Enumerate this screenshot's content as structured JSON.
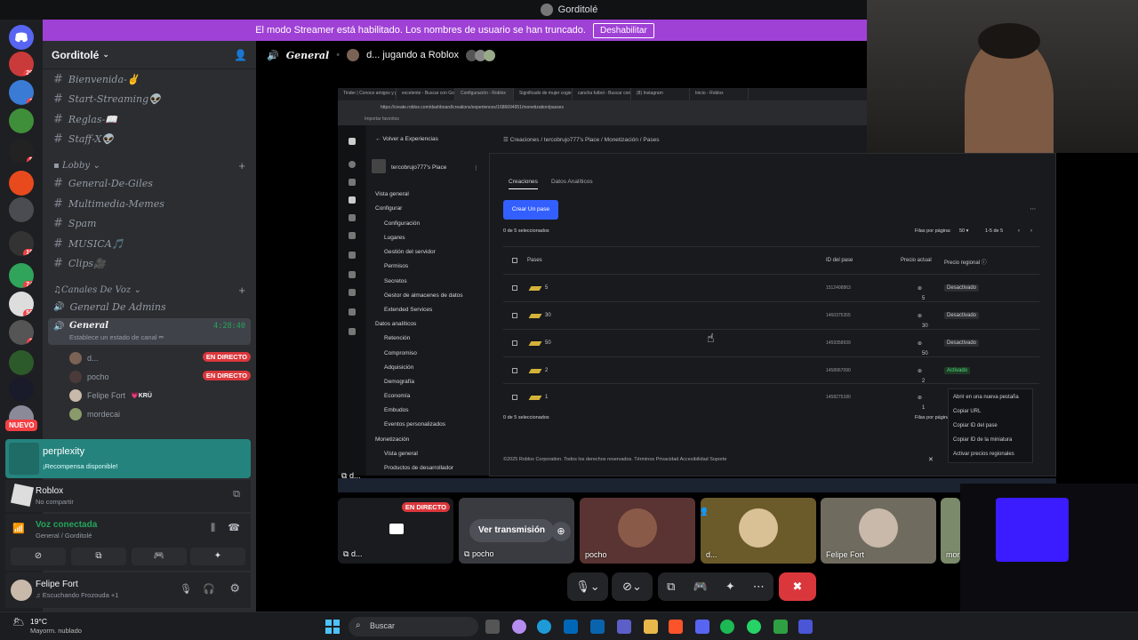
{
  "window_title": "Gorditolé",
  "banner": {
    "text": "El modo Streamer está habilitado. Los nombres de usuario se han truncado.",
    "button": "Deshabilitar"
  },
  "server_badges": [
    "29",
    "1",
    "5",
    "19",
    "74",
    "56",
    "3"
  ],
  "new_label": "NUEVO",
  "server": {
    "name": "Gorditolé"
  },
  "channels": [
    {
      "name": "Bienvenida-✌"
    },
    {
      "name": "Start-Streaming👽"
    },
    {
      "name": "Reglas-📖"
    },
    {
      "name": "Staff-X👽"
    }
  ],
  "category_lobby": "Lobby",
  "lobby_channels": [
    {
      "name": "General-De-Giles"
    },
    {
      "name": "Multimedia-Memes"
    },
    {
      "name": "Spam"
    },
    {
      "name": "MUSICA🎵"
    },
    {
      "name": "Clips🎥"
    }
  ],
  "category_voice": "Canales De Voz",
  "voice_channels": {
    "admins": "General De Admins",
    "general": "General",
    "general_time": "4:28:40",
    "general_status": "Establece un estado de canal ✏"
  },
  "voice_users": [
    {
      "name": "d...",
      "live": "EN DIRECTO"
    },
    {
      "name": "pocho",
      "live": "EN DIRECTO"
    },
    {
      "name": "Felipe Fort",
      "tag": "KRÜ"
    },
    {
      "name": "mordecai"
    }
  ],
  "activity_perplexity": {
    "title": "perplexity",
    "sub": "¡Recompensa disponible!"
  },
  "activity_roblox": {
    "title": "Roblox",
    "sub": "No compartir"
  },
  "voice_connected": {
    "title": "Voz conectada",
    "sub": "General / Gorditolé"
  },
  "current_user": {
    "name": "Felipe Fort",
    "status": "Escuchando Frozouda +1"
  },
  "header": {
    "channel": "General",
    "activity": "d... jugando a Roblox"
  },
  "browser": {
    "tabs": [
      "Tinder | Conoce amigos y p",
      "excelente - Buscar con Go",
      "Configuración - Roblox",
      "Significado de mujer cogie",
      "cancha futbol - Buscar con",
      "(8) Instagram",
      "Inicio - Roblox"
    ],
    "url": "https://create.roblox.com/dashboard/creations/experiences/1686694951/monetization/passes",
    "bookmark": "Importar favoritos"
  },
  "roblox": {
    "back": "Volver a Experiencias",
    "place": "tercobrujo777's Place",
    "nav": [
      "Vista general",
      "Configurar",
      "Configuración",
      "Lugares",
      "Gestión del servidor",
      "Permisos",
      "Secretos",
      "Gestor de almacenes de datos",
      "Extended Services",
      "Datos analíticos",
      "Retención",
      "Compromiso",
      "Adquisición",
      "Demografía",
      "Economía",
      "Embudos",
      "Eventos personalizados",
      "Monetización",
      "Vista general",
      "Productos de desarrollador"
    ],
    "breadcrumb": "Creaciones  /  tercobrujo777's Place  /  Monetización  /  Pases",
    "tab_creations": "Creaciones",
    "tab_analytics": "Datos Analíticos",
    "create_button": "Crear Un pase",
    "selected": "0 de 5 seleccionados",
    "rows_per_page": "Filas por página:",
    "rows_value": "50",
    "range": "1-5 de 5",
    "columns": [
      "Pases",
      "ID del pase",
      "Precio actual",
      "Precio regional ⓘ"
    ],
    "rows": [
      {
        "name": "5",
        "id": "1512408863",
        "price": "5",
        "status": "Desactivado",
        "on": false
      },
      {
        "name": "30",
        "id": "1460375355",
        "price": "30",
        "status": "Desactivado",
        "on": false
      },
      {
        "name": "50",
        "id": "1459358939",
        "price": "50",
        "status": "Desactivado",
        "on": false
      },
      {
        "name": "2",
        "id": "1458967090",
        "price": "2",
        "status": "Activado",
        "on": true
      },
      {
        "name": "1",
        "id": "1458275180",
        "price": "1",
        "status": "",
        "on": false
      }
    ],
    "footer": "©2025 Roblox Corporation. Todos los derechos reservados.   Términos    Privacidad    Accesibilidad    Soporte",
    "context_menu": [
      "Abrir en una nueva pestaña",
      "Copiar URL",
      "Copiar ID del pase",
      "Copiar ID de la miniatura",
      "Activar precios regionales"
    ]
  },
  "stream_label": "d...",
  "tiles": [
    {
      "name": "d...",
      "live": "EN DIRECTO"
    },
    {
      "name": "pocho",
      "action": "Ver transmisión"
    },
    {
      "name": "pocho"
    },
    {
      "name": "d..."
    },
    {
      "name": "Felipe Fort"
    },
    {
      "name": "mor..."
    }
  ],
  "taskbar": {
    "weather_temp": "19°C",
    "weather_desc": "Mayorm. nublado",
    "search": "Buscar"
  },
  "colors": {
    "accent_purple": "#a041d6",
    "discord_blurple": "#5865f2",
    "live_red": "#da373c",
    "roblox_blue": "#335fff",
    "voice_green": "#23a55a",
    "hangup_red": "#da373c"
  }
}
